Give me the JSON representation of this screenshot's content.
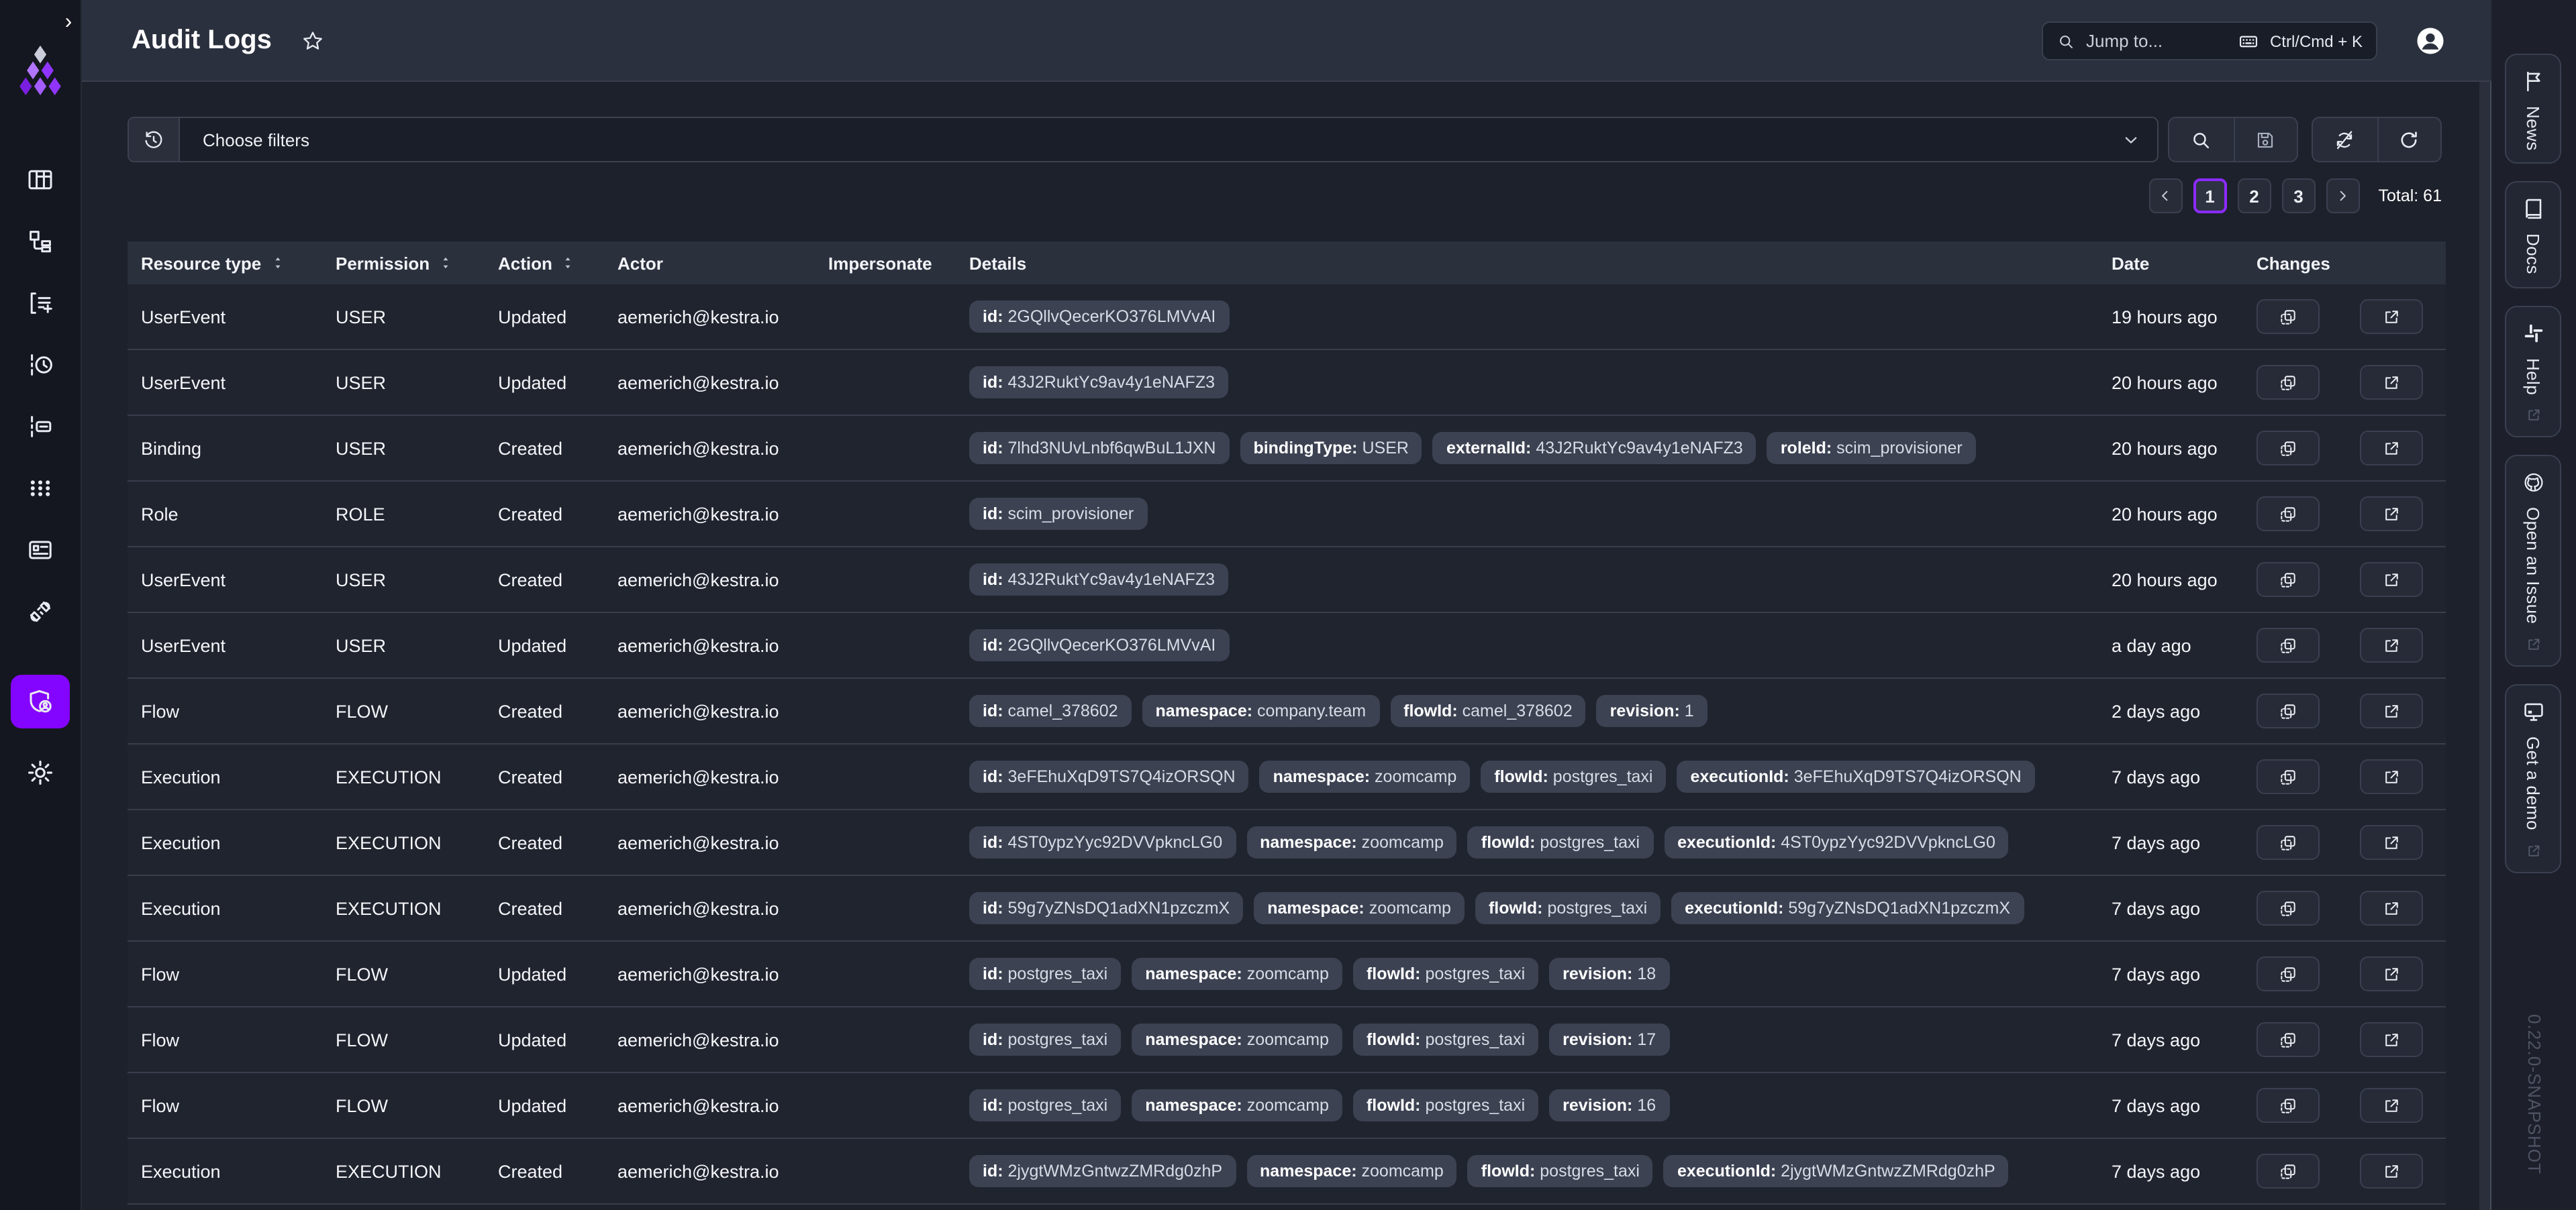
{
  "app": {
    "title": "Audit Logs",
    "version": "0.22.0-SNAPSHOT",
    "brand_color": "#8405FF"
  },
  "topbar": {
    "search_placeholder": "Jump to...",
    "search_shortcut": "Ctrl/Cmd + K",
    "search_icon": "magnifier",
    "shortcut_icon": "keyboard",
    "avatar_icon": "person-circle",
    "favorite_icon": "star"
  },
  "sidebar": {
    "collapse_icon": "chevron-right",
    "logo_icon": "kestra-logo",
    "items": [
      {
        "key": "dashboard",
        "icon": "grid",
        "active": false
      },
      {
        "key": "flows",
        "icon": "hierarchy",
        "active": false
      },
      {
        "key": "tests",
        "icon": "flow-plus",
        "active": false
      },
      {
        "key": "executions",
        "icon": "exec-clock",
        "active": false
      },
      {
        "key": "logs",
        "icon": "log-box",
        "active": false
      },
      {
        "key": "apps",
        "icon": "dots-grid",
        "active": false
      },
      {
        "key": "blueprints",
        "icon": "blueprint",
        "active": false
      },
      {
        "key": "plugins",
        "icon": "plug",
        "active": false
      },
      {
        "key": "administration",
        "icon": "shield-user",
        "active": true
      },
      {
        "key": "settings",
        "icon": "gear",
        "active": false
      }
    ]
  },
  "filter": {
    "history_icon": "history",
    "placeholder": "Choose filters",
    "dropdown_icon": "chevron-down"
  },
  "toolbar": {
    "groups": [
      [
        {
          "key": "search",
          "icon": "magnifier"
        },
        {
          "key": "save-filter",
          "icon": "floppy"
        }
      ],
      [
        {
          "key": "auto-refresh-off",
          "icon": "sync-off"
        },
        {
          "key": "refresh",
          "icon": "refresh"
        }
      ]
    ]
  },
  "pagination": {
    "prev_icon": "chevron-left",
    "next_icon": "chevron-right",
    "pages": [
      "1",
      "2",
      "3"
    ],
    "active_page": "1",
    "total_label": "Total: 61"
  },
  "table": {
    "columns": [
      {
        "key": "resource-type",
        "label": "Resource type",
        "sortable": true
      },
      {
        "key": "permission",
        "label": "Permission",
        "sortable": true
      },
      {
        "key": "action",
        "label": "Action",
        "sortable": true
      },
      {
        "key": "actor",
        "label": "Actor",
        "sortable": false
      },
      {
        "key": "impersonate",
        "label": "Impersonate",
        "sortable": false
      },
      {
        "key": "details",
        "label": "Details",
        "sortable": false
      },
      {
        "key": "date",
        "label": "Date",
        "sortable": false
      },
      {
        "key": "changes",
        "label": "Changes",
        "sortable": false
      }
    ],
    "row_actions": [
      {
        "key": "changes-diff",
        "icon": "diff"
      },
      {
        "key": "open-detail",
        "icon": "external"
      }
    ],
    "rows": [
      {
        "resource_type": "UserEvent",
        "permission": "USER",
        "action": "Updated",
        "actor": "aemerich@kestra.io",
        "impersonate": "",
        "details": [
          {
            "key": "id",
            "value": "2GQllvQecerKO376LMVvAI"
          }
        ],
        "date": "19 hours ago"
      },
      {
        "resource_type": "UserEvent",
        "permission": "USER",
        "action": "Updated",
        "actor": "aemerich@kestra.io",
        "impersonate": "",
        "details": [
          {
            "key": "id",
            "value": "43J2RuktYc9av4y1eNAFZ3"
          }
        ],
        "date": "20 hours ago"
      },
      {
        "resource_type": "Binding",
        "permission": "USER",
        "action": "Created",
        "actor": "aemerich@kestra.io",
        "impersonate": "",
        "details": [
          {
            "key": "id",
            "value": "7lhd3NUvLnbf6qwBuL1JXN"
          },
          {
            "key": "bindingType",
            "value": "USER"
          },
          {
            "key": "externalId",
            "value": "43J2RuktYc9av4y1eNAFZ3"
          },
          {
            "key": "roleId",
            "value": "scim_provisioner"
          }
        ],
        "date": "20 hours ago"
      },
      {
        "resource_type": "Role",
        "permission": "ROLE",
        "action": "Created",
        "actor": "aemerich@kestra.io",
        "impersonate": "",
        "details": [
          {
            "key": "id",
            "value": "scim_provisioner"
          }
        ],
        "date": "20 hours ago"
      },
      {
        "resource_type": "UserEvent",
        "permission": "USER",
        "action": "Created",
        "actor": "aemerich@kestra.io",
        "impersonate": "",
        "details": [
          {
            "key": "id",
            "value": "43J2RuktYc9av4y1eNAFZ3"
          }
        ],
        "date": "20 hours ago"
      },
      {
        "resource_type": "UserEvent",
        "permission": "USER",
        "action": "Updated",
        "actor": "aemerich@kestra.io",
        "impersonate": "",
        "details": [
          {
            "key": "id",
            "value": "2GQllvQecerKO376LMVvAI"
          }
        ],
        "date": "a day ago"
      },
      {
        "resource_type": "Flow",
        "permission": "FLOW",
        "action": "Created",
        "actor": "aemerich@kestra.io",
        "impersonate": "",
        "details": [
          {
            "key": "id",
            "value": "camel_378602"
          },
          {
            "key": "namespace",
            "value": "company.team"
          },
          {
            "key": "flowId",
            "value": "camel_378602"
          },
          {
            "key": "revision",
            "value": "1"
          }
        ],
        "date": "2 days ago"
      },
      {
        "resource_type": "Execution",
        "permission": "EXECUTION",
        "action": "Created",
        "actor": "aemerich@kestra.io",
        "impersonate": "",
        "details": [
          {
            "key": "id",
            "value": "3eFEhuXqD9TS7Q4izORSQN"
          },
          {
            "key": "namespace",
            "value": "zoomcamp"
          },
          {
            "key": "flowId",
            "value": "postgres_taxi"
          },
          {
            "key": "executionId",
            "value": "3eFEhuXqD9TS7Q4izORSQN"
          }
        ],
        "date": "7 days ago"
      },
      {
        "resource_type": "Execution",
        "permission": "EXECUTION",
        "action": "Created",
        "actor": "aemerich@kestra.io",
        "impersonate": "",
        "details": [
          {
            "key": "id",
            "value": "4ST0ypzYyc92DVVpkncLG0"
          },
          {
            "key": "namespace",
            "value": "zoomcamp"
          },
          {
            "key": "flowId",
            "value": "postgres_taxi"
          },
          {
            "key": "executionId",
            "value": "4ST0ypzYyc92DVVpkncLG0"
          }
        ],
        "date": "7 days ago"
      },
      {
        "resource_type": "Execution",
        "permission": "EXECUTION",
        "action": "Created",
        "actor": "aemerich@kestra.io",
        "impersonate": "",
        "details": [
          {
            "key": "id",
            "value": "59g7yZNsDQ1adXN1pzczmX"
          },
          {
            "key": "namespace",
            "value": "zoomcamp"
          },
          {
            "key": "flowId",
            "value": "postgres_taxi"
          },
          {
            "key": "executionId",
            "value": "59g7yZNsDQ1adXN1pzczmX"
          }
        ],
        "date": "7 days ago"
      },
      {
        "resource_type": "Flow",
        "permission": "FLOW",
        "action": "Updated",
        "actor": "aemerich@kestra.io",
        "impersonate": "",
        "details": [
          {
            "key": "id",
            "value": "postgres_taxi"
          },
          {
            "key": "namespace",
            "value": "zoomcamp"
          },
          {
            "key": "flowId",
            "value": "postgres_taxi"
          },
          {
            "key": "revision",
            "value": "18"
          }
        ],
        "date": "7 days ago"
      },
      {
        "resource_type": "Flow",
        "permission": "FLOW",
        "action": "Updated",
        "actor": "aemerich@kestra.io",
        "impersonate": "",
        "details": [
          {
            "key": "id",
            "value": "postgres_taxi"
          },
          {
            "key": "namespace",
            "value": "zoomcamp"
          },
          {
            "key": "flowId",
            "value": "postgres_taxi"
          },
          {
            "key": "revision",
            "value": "17"
          }
        ],
        "date": "7 days ago"
      },
      {
        "resource_type": "Flow",
        "permission": "FLOW",
        "action": "Updated",
        "actor": "aemerich@kestra.io",
        "impersonate": "",
        "details": [
          {
            "key": "id",
            "value": "postgres_taxi"
          },
          {
            "key": "namespace",
            "value": "zoomcamp"
          },
          {
            "key": "flowId",
            "value": "postgres_taxi"
          },
          {
            "key": "revision",
            "value": "16"
          }
        ],
        "date": "7 days ago"
      },
      {
        "resource_type": "Execution",
        "permission": "EXECUTION",
        "action": "Created",
        "actor": "aemerich@kestra.io",
        "impersonate": "",
        "details": [
          {
            "key": "id",
            "value": "2jygtWMzGntwzZMRdg0zhP"
          },
          {
            "key": "namespace",
            "value": "zoomcamp"
          },
          {
            "key": "flowId",
            "value": "postgres_taxi"
          },
          {
            "key": "executionId",
            "value": "2jygtWMzGntwzZMRdg0zhP"
          }
        ],
        "date": "7 days ago"
      }
    ]
  },
  "right_rail": {
    "tabs": [
      {
        "key": "news",
        "label": "News",
        "icon": "flag",
        "external": false
      },
      {
        "key": "docs",
        "label": "Docs",
        "icon": "book",
        "external": false
      },
      {
        "key": "help",
        "label": "Help",
        "icon": "slack",
        "external": true
      },
      {
        "key": "open-an-issue",
        "label": "Open an Issue",
        "icon": "github",
        "external": true
      },
      {
        "key": "get-a-demo",
        "label": "Get a demo",
        "icon": "monitor",
        "external": true
      }
    ]
  }
}
